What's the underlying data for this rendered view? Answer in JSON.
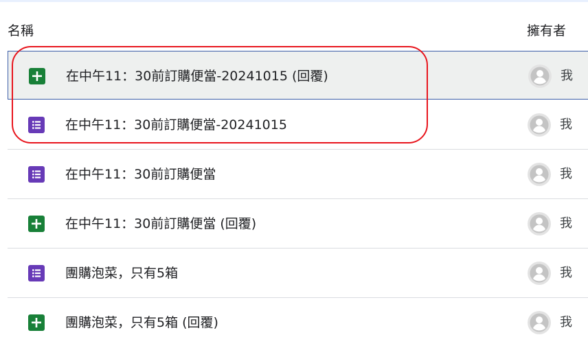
{
  "header": {
    "name_label": "名稱",
    "owner_label": "擁有者"
  },
  "colors": {
    "sheets_green": "#188038",
    "forms_purple": "#673ab7",
    "selection_background": "#eef0ef",
    "selection_border": "#3c5ea8",
    "annotation_red": "#e8141c"
  },
  "files": [
    {
      "name": "在中午11：30前訂購便當-20241015 (回覆)",
      "icon": "google-sheets-icon",
      "owner": "我",
      "selected": true
    },
    {
      "name": "在中午11：30前訂購便當-20241015",
      "icon": "google-forms-icon",
      "owner": "我",
      "selected": false
    },
    {
      "name": "在中午11：30前訂購便當",
      "icon": "google-forms-icon",
      "owner": "我",
      "selected": false
    },
    {
      "name": "在中午11：30前訂購便當 (回覆)",
      "icon": "google-sheets-icon",
      "owner": "我",
      "selected": false
    },
    {
      "name": "團購泡菜，只有5箱",
      "icon": "google-forms-icon",
      "owner": "我",
      "selected": false
    },
    {
      "name": "團購泡菜，只有5箱 (回覆)",
      "icon": "google-sheets-icon",
      "owner": "我",
      "selected": false
    }
  ]
}
